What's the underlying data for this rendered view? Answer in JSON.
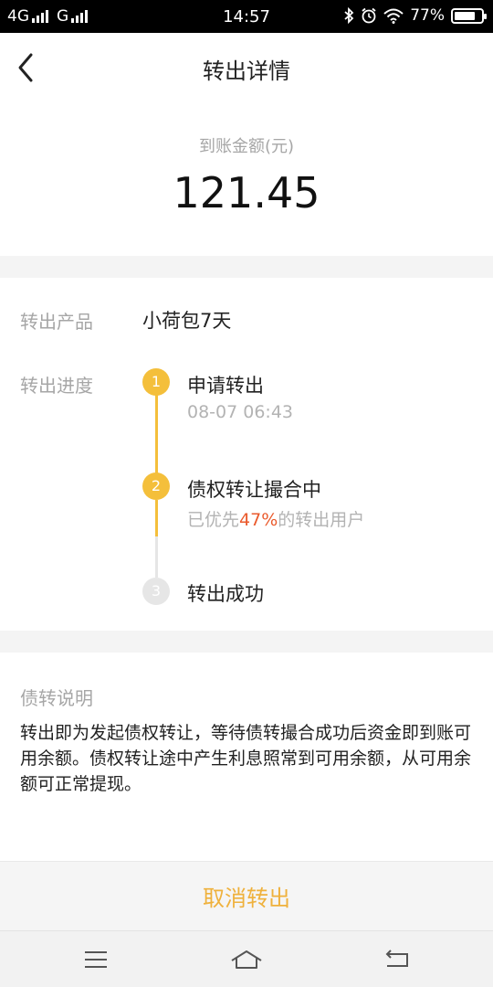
{
  "status_bar": {
    "network_1": "4G",
    "network_2": "G",
    "time": "14:57",
    "battery_text": "77%",
    "battery_level": 0.77
  },
  "header": {
    "title": "转出详情",
    "back_icon": "chevron-left-icon"
  },
  "amount": {
    "label": "到账金额(元)",
    "value": "121.45"
  },
  "details": {
    "product_label": "转出产品",
    "product_value": "小荷包7天",
    "progress_label": "转出进度",
    "steps": [
      {
        "number": "1",
        "title": "申请转出",
        "subtitle": "08-07 06:43",
        "status": "done"
      },
      {
        "number": "2",
        "title": "债权转让撮合中",
        "subtitle_prefix": "已优先",
        "subtitle_highlight": "47%",
        "subtitle_suffix": "的转出用户",
        "status": "active"
      },
      {
        "number": "3",
        "title": "转出成功",
        "status": "pending"
      }
    ]
  },
  "notes": {
    "title": "债转说明",
    "body": "转出即为发起债权转让，等待债转撮合成功后资金即到账可用余额。债权转让途中产生利息照常到可用余额，从可用余额可正常提现。"
  },
  "actions": {
    "cancel_label": "取消转出"
  },
  "colors": {
    "accent": "#f4bf3b",
    "highlight": "#ea5a2c",
    "pending": "#e6e6e6",
    "cancel_text": "#efb13c"
  },
  "nav_bar": {
    "icons": [
      "menu-icon",
      "home-icon",
      "back-icon"
    ]
  }
}
